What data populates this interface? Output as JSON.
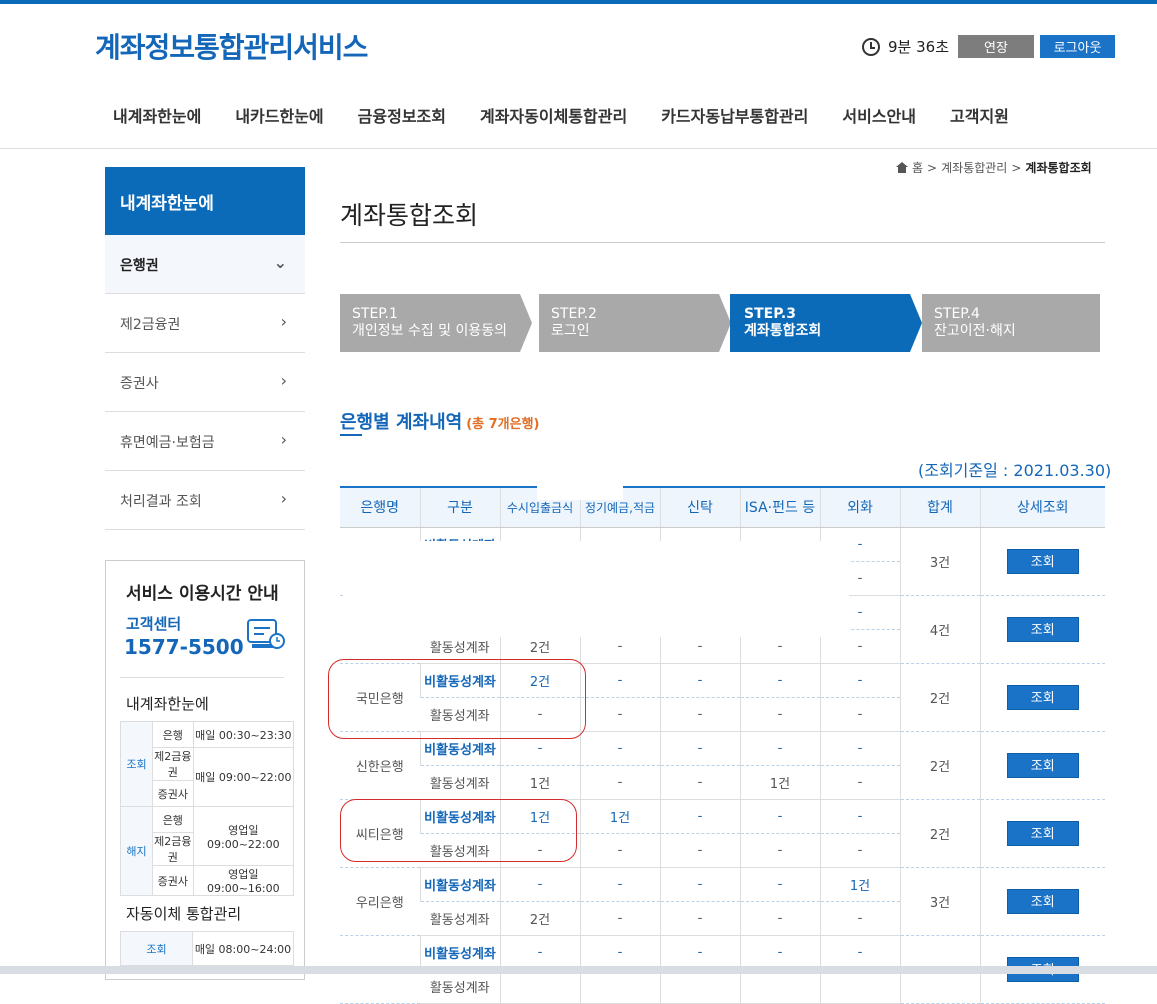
{
  "header": {
    "logo": "계좌정보통합관리서비스",
    "timer": "9분 36초",
    "extend_label": "연장",
    "logout_label": "로그아웃"
  },
  "gnb": [
    "내계좌한눈에",
    "내카드한눈에",
    "금융정보조회",
    "계좌자동이체통합관리",
    "카드자동납부통합관리",
    "서비스안내",
    "고객지원"
  ],
  "lnb": {
    "title": "내계좌한눈에",
    "items": [
      {
        "label": "은행권",
        "chevron": "⌄"
      },
      {
        "label": "제2금융권",
        "chevron": "›"
      },
      {
        "label": "증권사",
        "chevron": "›"
      },
      {
        "label": "휴면예금·보험금",
        "chevron": "›"
      },
      {
        "label": "처리결과 조회",
        "chevron": "›"
      }
    ]
  },
  "service": {
    "title": "서비스 이용시간 안내",
    "center_label": "고객센터",
    "phone": "1577-5500",
    "sub1": "내계좌한눈에",
    "rows": [
      {
        "cat": "조회",
        "org": "은행",
        "time": "매일 00:30~23:30"
      },
      {
        "org": "제2금융권",
        "time": "매일 09:00~22:00"
      },
      {
        "org": "증권사"
      },
      {
        "cat": "해지",
        "org": "은행",
        "time": "영업일 09:00~22:00"
      },
      {
        "org": "제2금융권"
      },
      {
        "org": "증권사",
        "time": "영업일 09:00~16:00"
      }
    ],
    "sub2": "자동이체 통합관리",
    "auto_row": {
      "cat": "조회",
      "time": "매일 08:00~24:00"
    }
  },
  "breadcrumb": {
    "home": "홈",
    "mid": "계좌통합관리",
    "current": "계좌통합조회"
  },
  "page_title": "계좌통합조회",
  "steps": [
    {
      "num": "STEP.1",
      "label": "개인정보 수집 및 이용동의"
    },
    {
      "num": "STEP.2",
      "label": "로그인"
    },
    {
      "num": "STEP.3",
      "label": "계좌통합조회"
    },
    {
      "num": "STEP.4",
      "label": "잔고이전·해지"
    }
  ],
  "section": {
    "title": "은행별 계좌내역",
    "count": "(총 7개은행)",
    "as_of": "(조회기준일 : 2021.03.30)"
  },
  "table": {
    "headers": [
      "은행명",
      "구분",
      "수시입출금식",
      "정기예금,적금",
      "신탁",
      "ISA·펀드 등",
      "외화",
      "합계",
      "상세조회"
    ],
    "button_label": "조회",
    "rows": [
      {
        "bank": "",
        "inactive": [
          "",
          "",
          "",
          "",
          "-"
        ],
        "active": [
          "",
          "",
          "",
          "",
          "-"
        ],
        "total": "3건"
      },
      {
        "bank": "",
        "inactive": [
          "",
          "",
          "",
          "",
          "-"
        ],
        "active": [
          "2건",
          "-",
          "-",
          "-",
          "-"
        ],
        "total": "4건"
      },
      {
        "bank": "국민은행",
        "inactive": [
          "2건",
          "-",
          "-",
          "-",
          "-"
        ],
        "active": [
          "-",
          "-",
          "-",
          "-",
          "-"
        ],
        "total": "2건"
      },
      {
        "bank": "신한은행",
        "inactive": [
          "-",
          "-",
          "-",
          "-",
          "-"
        ],
        "active": [
          "1건",
          "-",
          "-",
          "1건",
          "-"
        ],
        "total": "2건"
      },
      {
        "bank": "씨티은행",
        "inactive": [
          "1건",
          "1건",
          "-",
          "-",
          "-"
        ],
        "active": [
          "-",
          "-",
          "-",
          "-",
          "-"
        ],
        "total": "2건"
      },
      {
        "bank": "우리은행",
        "inactive": [
          "-",
          "-",
          "-",
          "-",
          "1건"
        ],
        "active": [
          "2건",
          "-",
          "-",
          "-",
          "-"
        ],
        "total": "3건"
      },
      {
        "bank": "",
        "inactive": [
          "-",
          "-",
          "-",
          "-",
          "-"
        ],
        "active": [
          "",
          "",
          "",
          "",
          ""
        ],
        "total": ""
      }
    ],
    "inactive_label": "비활동성계좌",
    "active_label": "활동성계좌"
  }
}
